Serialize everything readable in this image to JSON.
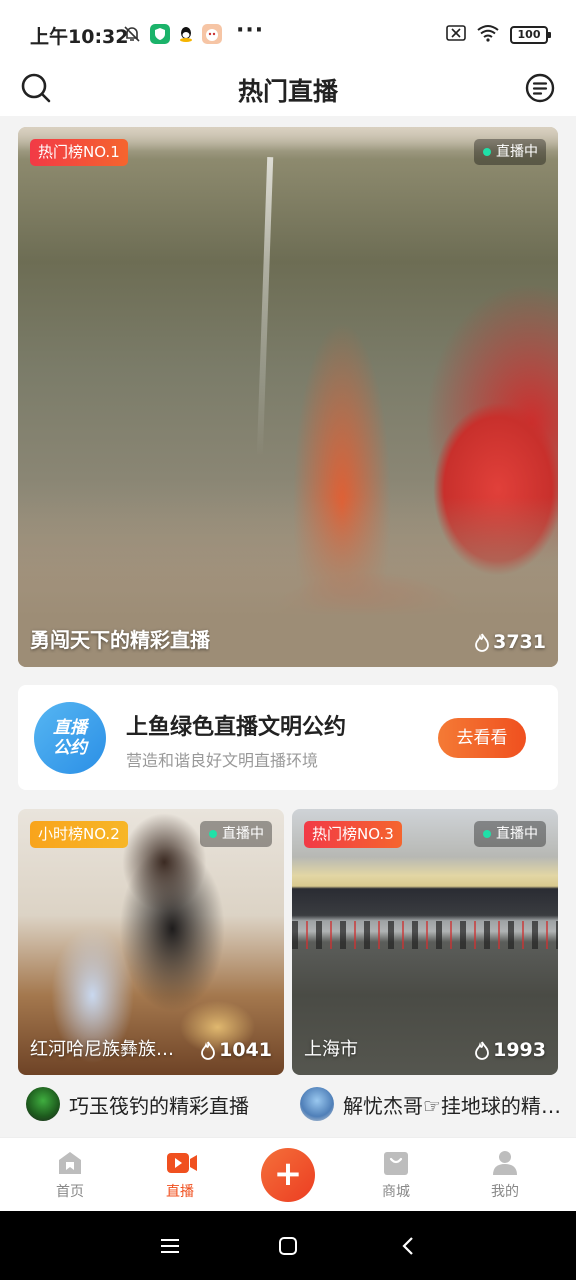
{
  "status_bar": {
    "time": "上午10:32",
    "icons": [
      "bell-off-icon",
      "shield-app-icon",
      "qq-icon",
      "app-icon"
    ],
    "more": "···",
    "battery": "100"
  },
  "header": {
    "title": "热门直播",
    "left_icon": "search-icon",
    "right_icon": "menu-list-icon"
  },
  "featured": {
    "rank_badge": "热门榜NO.1",
    "live_label": "直播中",
    "title": "勇闯天下的精彩直播",
    "heat": "3731"
  },
  "pact_banner": {
    "logo_line1": "直播",
    "logo_line2": "公约",
    "title": "上鱼绿色直播文明公约",
    "subtitle": "营造和谐良好文明直播环境",
    "button": "去看看"
  },
  "grid_cards": [
    {
      "rank_badge": "小时榜NO.2",
      "live_label": "直播中",
      "location": "红河哈尼族彝族自治州",
      "heat": "1041",
      "streamer": "巧玉筏钓的精彩直播"
    },
    {
      "rank_badge": "热门榜NO.3",
      "live_label": "直播中",
      "location": "上海市",
      "heat": "1993",
      "streamer": "解忧杰哥☞挂地球的精彩直播"
    }
  ],
  "bottom_nav": [
    {
      "label": "首页",
      "icon": "home-icon",
      "active": false
    },
    {
      "label": "直播",
      "icon": "video-camera-icon",
      "active": true
    },
    {
      "label": "",
      "icon": "plus-icon",
      "active": false
    },
    {
      "label": "商城",
      "icon": "shop-bag-icon",
      "active": false
    },
    {
      "label": "我的",
      "icon": "person-icon",
      "active": false
    }
  ],
  "colors": {
    "accent": "#f0501f",
    "badge_red": "#f23a46",
    "badge_yellow": "#f8a41c",
    "live_dot": "#1fe0a8",
    "pact_blue": "#2b8fe6"
  },
  "system_nav": [
    "menu-icon",
    "home-square-icon",
    "back-icon"
  ]
}
